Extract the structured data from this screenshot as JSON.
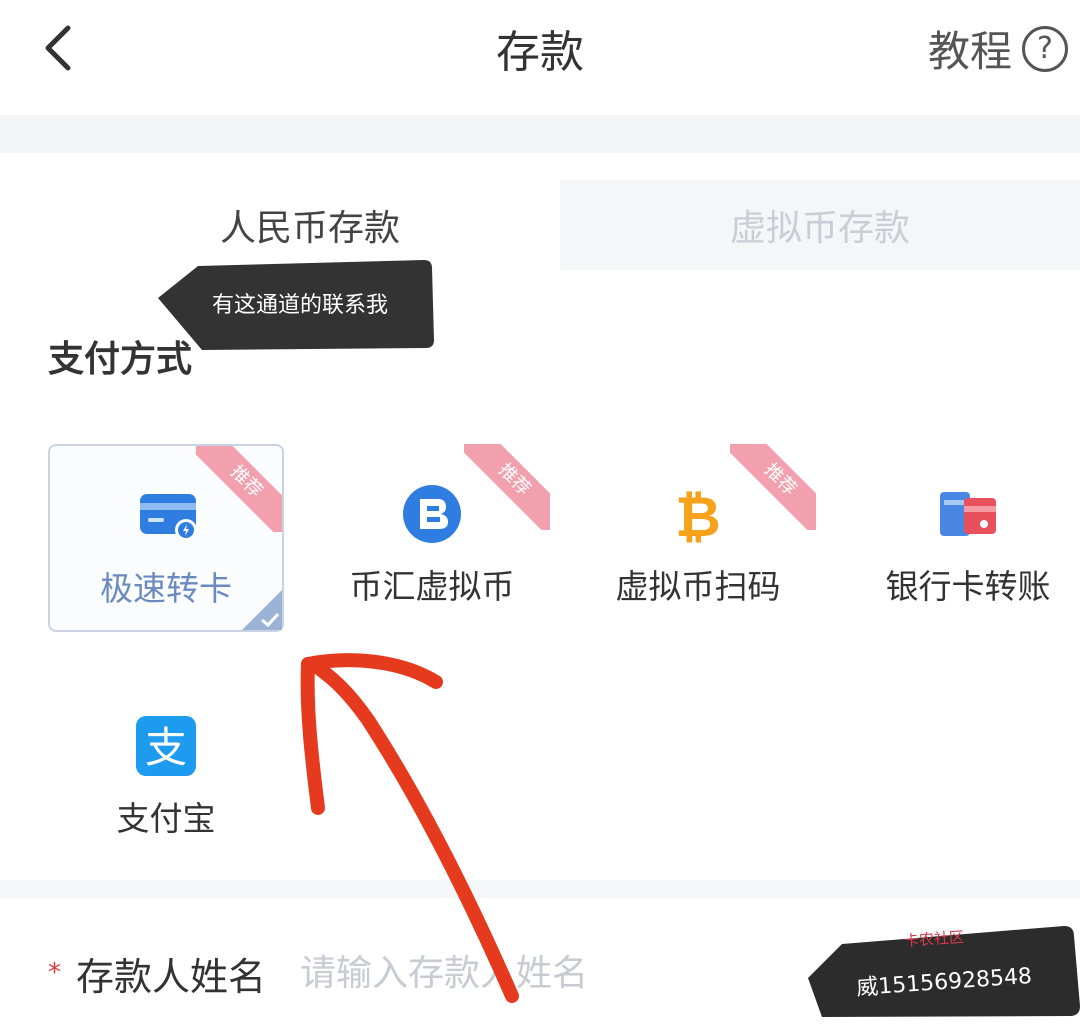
{
  "header": {
    "title": "存款",
    "tutorial_label": "教程",
    "help_glyph": "?"
  },
  "tabs": [
    {
      "label": "人民币存款",
      "active": true
    },
    {
      "label": "虚拟币存款",
      "active": false
    }
  ],
  "tooltip": {
    "text": "有这通道的联系我"
  },
  "payment": {
    "section_title": "支付方式",
    "methods": [
      {
        "label": "极速转卡",
        "badge": "推荐",
        "selected": true,
        "icon": "card-transfer-icon"
      },
      {
        "label": "币汇虚拟币",
        "badge": "推荐",
        "selected": false,
        "icon": "bihui-coin-icon"
      },
      {
        "label": "虚拟币扫码",
        "badge": "推荐",
        "selected": false,
        "icon": "bitcoin-icon"
      },
      {
        "label": "银行卡转账",
        "badge": "",
        "selected": false,
        "icon": "bank-card-icon"
      },
      {
        "label": "支付宝",
        "badge": "",
        "selected": false,
        "icon": "alipay-icon"
      }
    ]
  },
  "form": {
    "required_mark": "*",
    "depositor_label": "存款人姓名",
    "depositor_placeholder": "请输入存款人姓名",
    "depositor_value": ""
  },
  "watermark": {
    "text": "威15156928548",
    "logo_text": "卡农社区"
  },
  "colors": {
    "annotation_arrow": "#e63a1e",
    "accent_blue": "#2f7de1",
    "badge_pink": "#f2a0ae",
    "bitcoin_orange": "#f7a21b",
    "selected_label": "#6b8bc0"
  }
}
